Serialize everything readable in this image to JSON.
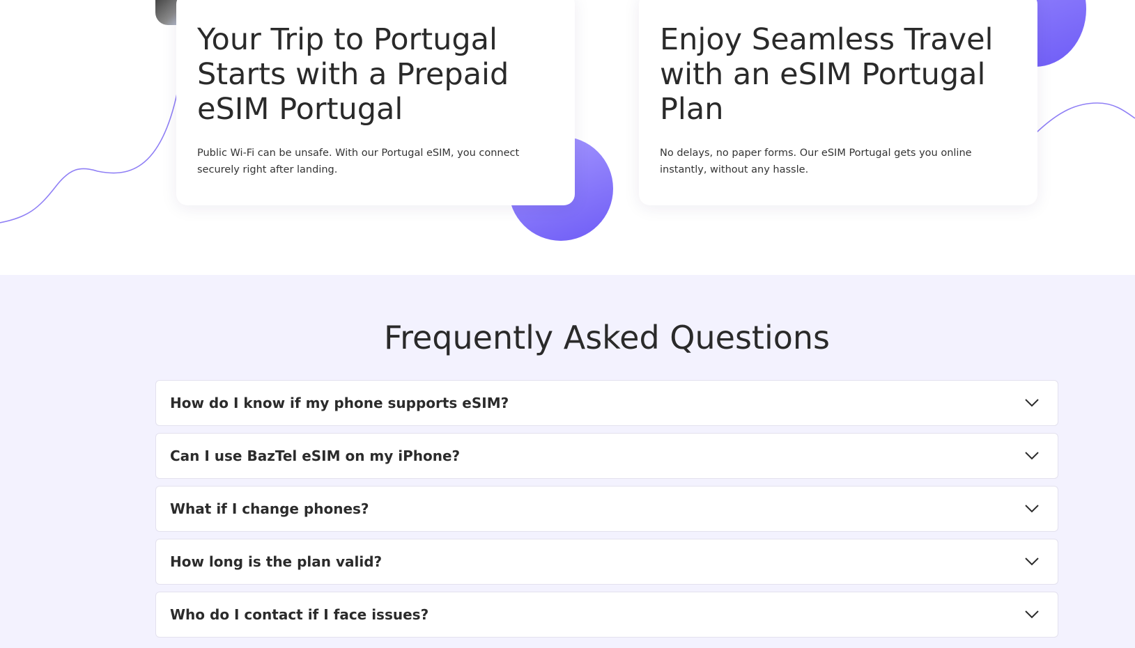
{
  "cards": [
    {
      "title": "Your Trip to Portugal Starts with a Prepaid eSIM Portugal",
      "body": "Public Wi-Fi can be unsafe. With our Portugal eSIM, you connect securely right after landing."
    },
    {
      "title": "Enjoy Seamless Travel with an eSIM Portugal Plan",
      "body": "No delays, no paper forms. Our eSIM Portugal gets you online instantly, without any hassle."
    }
  ],
  "faq": {
    "title": "Frequently Asked Questions",
    "items": [
      {
        "question": "How do I know if my phone supports eSIM?",
        "icon": "chevron-down-icon"
      },
      {
        "question": "Can I use BazTel eSIM on my iPhone?",
        "icon": "chevron-down-icon"
      },
      {
        "question": "What if I change phones?",
        "icon": "chevron-down-icon"
      },
      {
        "question": "How long is the plan valid?",
        "icon": "chevron-down-icon"
      },
      {
        "question": "Who do I contact if I face issues?",
        "icon": "chevron-down-icon"
      }
    ]
  },
  "colors": {
    "accent": "#6e5cf6",
    "accent_light": "#a89bff",
    "faq_background": "#f3f2fe",
    "text": "#2b2b2b"
  }
}
